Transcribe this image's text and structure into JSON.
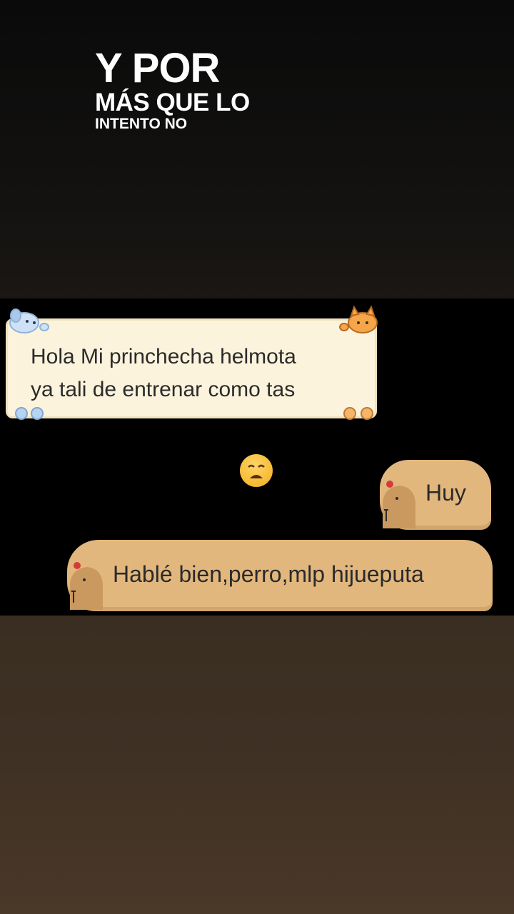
{
  "caption": {
    "line1": "Y POR",
    "line2": "MÁS QUE LO",
    "line3": "INTENTO NO"
  },
  "chat": {
    "note": {
      "line1": "Hola Mi princhecha helmota",
      "line2": "ya tali de entrenar como tas"
    },
    "reaction_icon": "weary-face-emoji",
    "messages": [
      {
        "text": "Huy",
        "avatar": "capybara-icon"
      },
      {
        "text": "Hablé bien,perro,mlp hijueputa",
        "avatar": "capybara-icon"
      }
    ]
  },
  "colors": {
    "note_bg": "#fbf3dc",
    "bubble_bg": "#e2b77d",
    "caption_text": "#ffffff",
    "chat_bg": "#000000"
  }
}
